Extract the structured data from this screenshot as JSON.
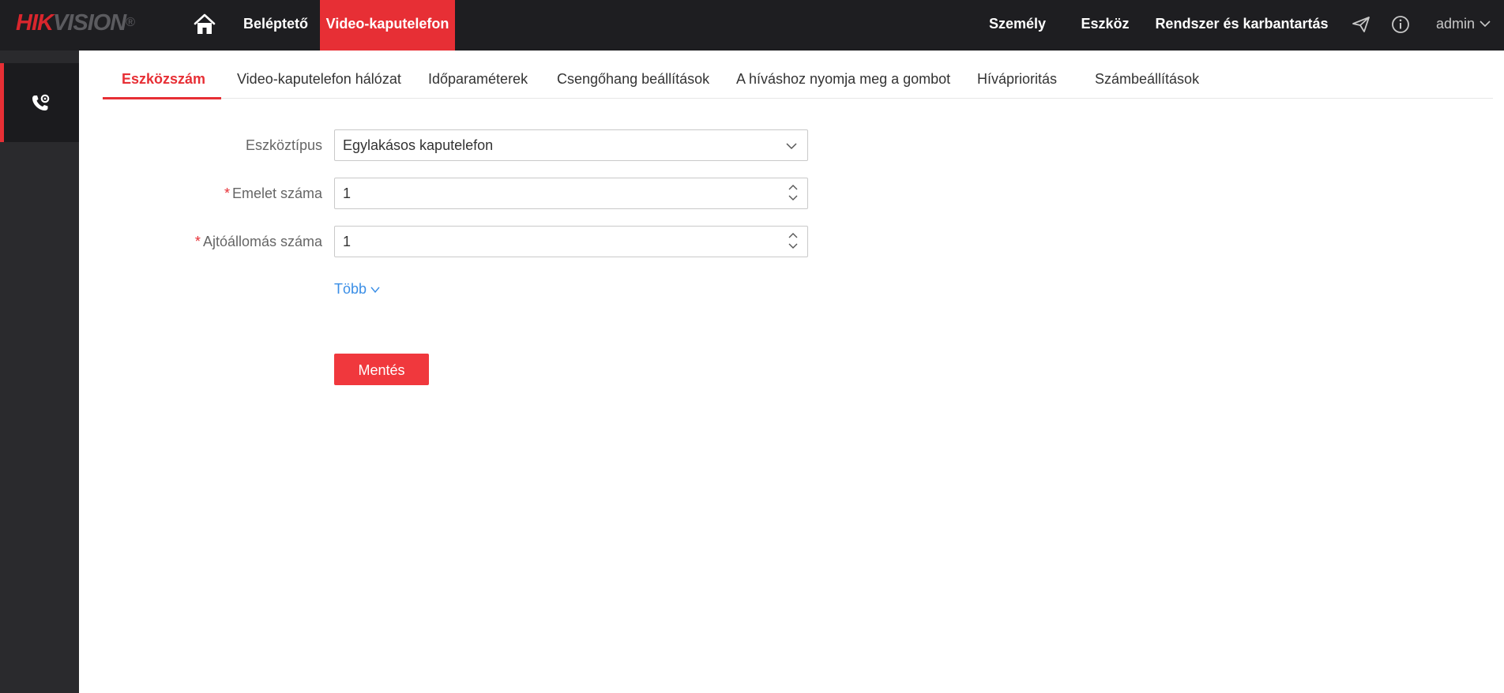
{
  "brand": {
    "part1": "HIK",
    "part2": "VISION",
    "reg": "®"
  },
  "topnav": {
    "left": [
      "Beléptető",
      "Video-kaputelefon"
    ],
    "right": [
      "Személy",
      "Eszköz",
      "Rendszer és karbantartás"
    ],
    "user": "admin"
  },
  "tabs": [
    "Eszközszám",
    "Video-kaputelefon hálózat",
    "Időparaméterek",
    "Csengőhang beállítások",
    "A híváshoz nyomja meg a gombot",
    "Híváprioritás",
    "Számbeállítások"
  ],
  "form": {
    "device_type": {
      "label": "Eszköztípus",
      "value": "Egylakásos kaputelefon"
    },
    "floor_no": {
      "required": "*",
      "label": "Emelet száma",
      "value": "1"
    },
    "door_station_no": {
      "required": "*",
      "label": "Ajtóállomás száma",
      "value": "1"
    },
    "more": "Több",
    "save": "Mentés"
  },
  "colors": {
    "accent": "#e72f35",
    "topbar": "#1e1e21",
    "sidebar": "#2a2a2d",
    "link": "#3a8ee6"
  }
}
